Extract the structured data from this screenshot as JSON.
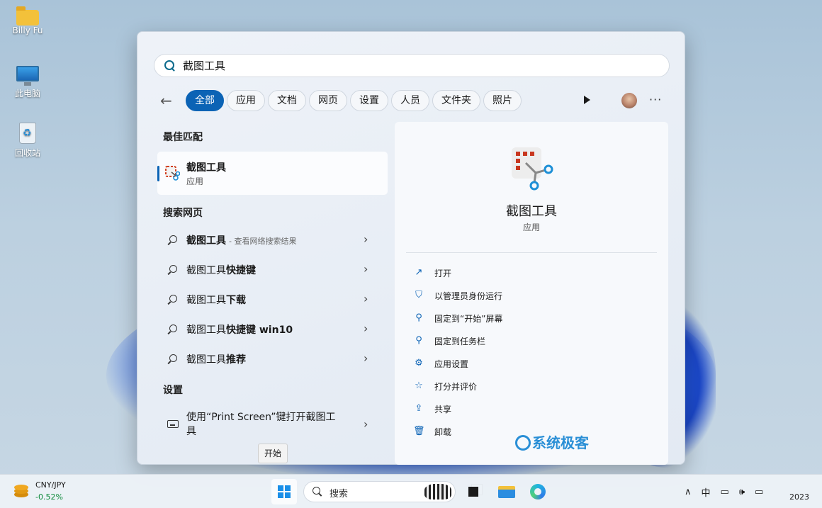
{
  "desktop": {
    "icons": [
      {
        "label": "Billy Fu",
        "icon": "folder-icon"
      },
      {
        "label": "此电脑",
        "icon": "computer-icon"
      },
      {
        "label": "回收站",
        "icon": "recycle-bin-icon"
      }
    ]
  },
  "search": {
    "query": "截图工具"
  },
  "filters": {
    "back_icon": "back-arrow-icon",
    "chips": [
      "全部",
      "应用",
      "文档",
      "网页",
      "设置",
      "人员",
      "文件夹",
      "照片"
    ],
    "active": "全部",
    "more": "···"
  },
  "left": {
    "best_match_title": "最佳匹配",
    "best_match": {
      "name": "截图工具",
      "type": "应用"
    },
    "web_title": "搜索网页",
    "web_items": [
      {
        "prefix": "截图工具",
        "suffix": "",
        "hint": "- 查看网络搜索结果"
      },
      {
        "prefix": "截图工具",
        "suffix": "快捷键",
        "hint": ""
      },
      {
        "prefix": "截图工具",
        "suffix": "下载",
        "hint": ""
      },
      {
        "prefix": "截图工具",
        "suffix": "快捷键 win10",
        "hint": ""
      },
      {
        "prefix": "截图工具",
        "suffix": "推荐",
        "hint": ""
      }
    ],
    "settings_title": "设置",
    "setting_item": "使用“Print Screen”键打开截图工具"
  },
  "detail": {
    "app_name": "截图工具",
    "app_type": "应用",
    "actions": [
      {
        "label": "打开",
        "icon": "open-icon"
      },
      {
        "label": "以管理员身份运行",
        "icon": "admin-shield-icon"
      },
      {
        "label": "固定到“开始”屏幕",
        "icon": "pin-icon"
      },
      {
        "label": "固定到任务栏",
        "icon": "pin-icon"
      },
      {
        "label": "应用设置",
        "icon": "gear-icon"
      },
      {
        "label": "打分并评价",
        "icon": "star-icon"
      },
      {
        "label": "共享",
        "icon": "share-icon"
      },
      {
        "label": "卸载",
        "icon": "trash-icon"
      }
    ],
    "watermark": "系统极客"
  },
  "tooltip": "开始",
  "taskbar": {
    "widget_pair": "CNY/JPY",
    "widget_change": "-0.52%",
    "search_placeholder": "搜索",
    "ime": "中",
    "year": "2023"
  },
  "colors": {
    "accent": "#0b63b5",
    "change_green": "#0d8a3a"
  }
}
